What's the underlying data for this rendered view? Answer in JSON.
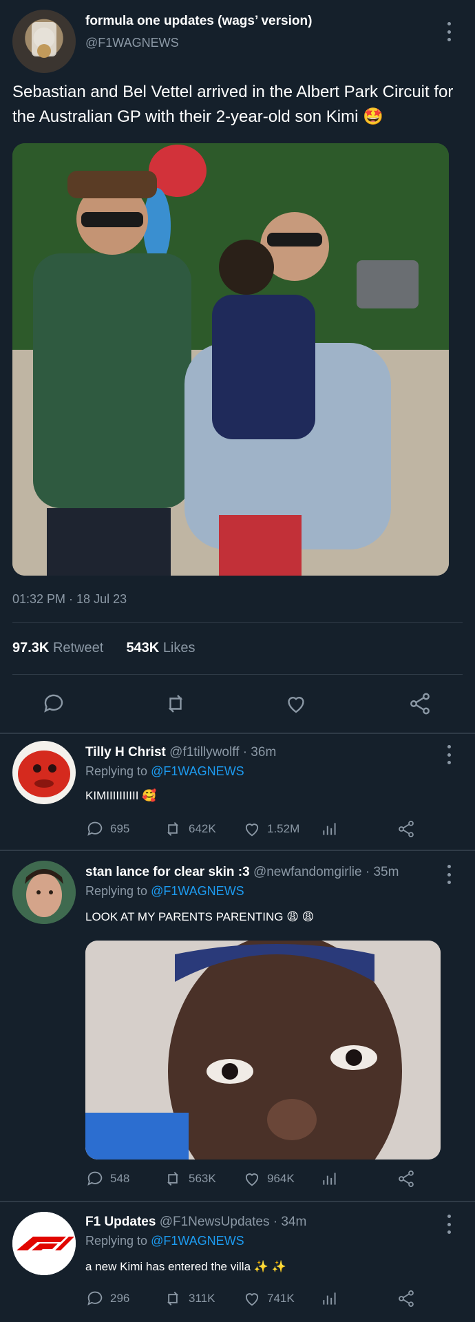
{
  "main_tweet": {
    "display_name": "formula one updates (wags’ version)",
    "handle": "@F1WAGNEWS",
    "text": "Sebastian and Bel Vettel arrived in the Albert Park Circuit for the Australian GP with their 2-year-old son Kimi 🤩",
    "timestamp": "01:32 PM · 18 Jul 23",
    "retweets_count": "97.3K",
    "retweets_label": "Retweet",
    "likes_count": "543K",
    "likes_label": "Likes"
  },
  "replies": [
    {
      "name": "Tilly H Christ",
      "handle_time": "@f1tillywolff · 36m",
      "replying_prefix": "Replying to",
      "replying_handle": "@F1WAGNEWS",
      "text": "KIMIIIIIIIIII 🥰",
      "replies": "695",
      "retweets": "642K",
      "likes": "1.52M"
    },
    {
      "name": "stan lance for clear skin :3",
      "handle_time": "@newfandomgirlie · 35m",
      "replying_prefix": "Replying to",
      "replying_handle": "@F1WAGNEWS",
      "text": "LOOK AT MY PARENTS PARENTING 😩 😩",
      "replies": "548",
      "retweets": "563K",
      "likes": "964K"
    },
    {
      "name": "F1 Updates",
      "handle_time": "@F1NewsUpdates · 34m",
      "replying_prefix": "Replying to",
      "replying_handle": "@F1WAGNEWS",
      "text": "a new Kimi has entered the villa ✨ ✨",
      "replies": "296",
      "retweets": "311K",
      "likes": "741K"
    }
  ],
  "colors": {
    "background": "#15202b",
    "accent": "#1d9bf0",
    "muted": "#8b98a5",
    "divider": "#2f3b47"
  }
}
